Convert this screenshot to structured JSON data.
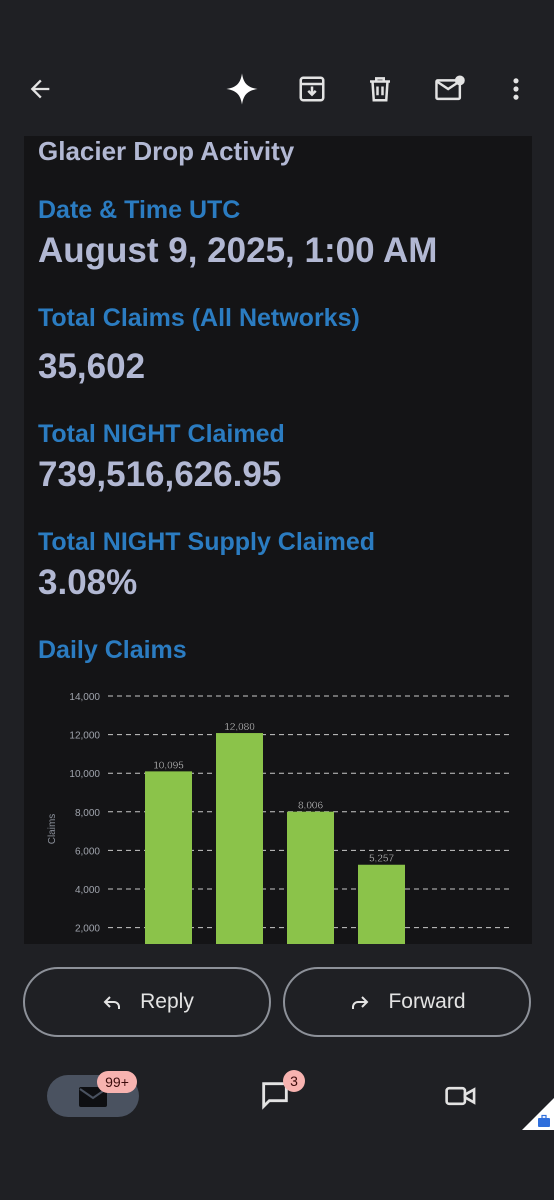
{
  "toolbar": {
    "back_icon": "arrow-left-icon",
    "gemini_icon": "sparkle-icon",
    "archive_icon": "archive-icon",
    "delete_icon": "trash-icon",
    "mark_unread_icon": "mail-unread-icon",
    "more_icon": "more-vert-icon"
  },
  "email": {
    "title": "Glacier Drop Activity",
    "date_label": "Date & Time UTC",
    "date_value": "August 9, 2025, 1:00 AM",
    "claims_label": "Total Claims (All Networks)",
    "claims_value": "35,602",
    "night_label": "Total NIGHT Claimed",
    "night_value": "739,516,626.95",
    "supply_label": "Total NIGHT Supply Claimed",
    "supply_value": "3.08%",
    "daily_label": "Daily Claims"
  },
  "chart_data": {
    "type": "bar",
    "categories": [
      "",
      "",
      "",
      ""
    ],
    "values": [
      10095,
      12080,
      8006,
      5257
    ],
    "value_labels": [
      "10,095",
      "12,080",
      "8,006",
      "5,257"
    ],
    "ylabel": "Claims",
    "yticks": [
      "2,000",
      "4,000",
      "6,000",
      "8,000",
      "10,000",
      "12,000",
      "14,000"
    ],
    "ylim": [
      0,
      14000
    ],
    "grid": true,
    "bar_color": "#8bc34a"
  },
  "actions": {
    "reply_label": "Reply",
    "forward_label": "Forward"
  },
  "nav": {
    "mail_badge": "99+",
    "chat_badge": "3",
    "mail_icon": "mail-icon",
    "chat_icon": "chat-icon",
    "meet_icon": "video-icon"
  },
  "colors": {
    "label_blue": "#2b7cc1",
    "value_text": "#b2b8d3",
    "bar_green": "#8bc34a"
  }
}
